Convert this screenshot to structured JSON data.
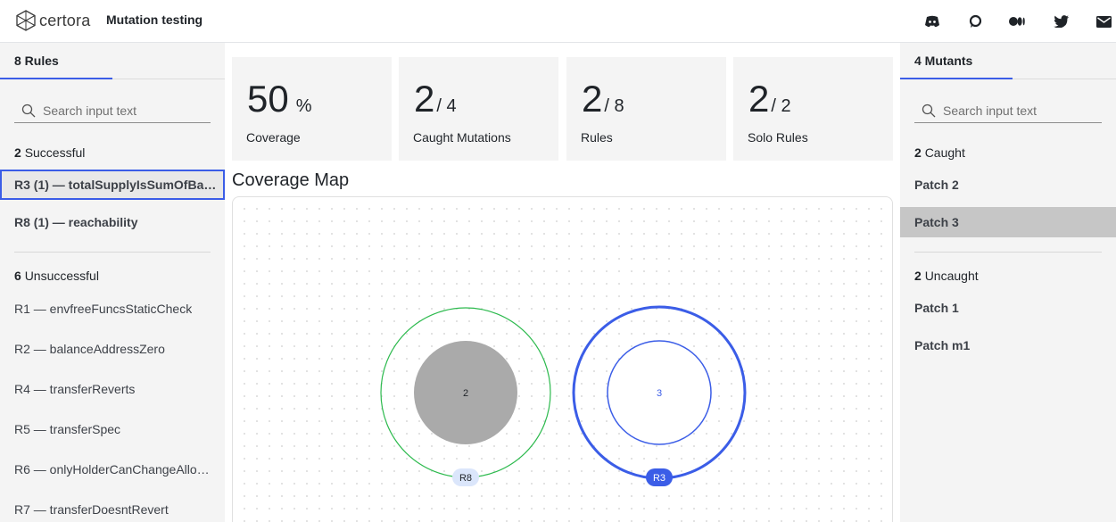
{
  "header": {
    "brand": "certora",
    "title": "Mutation testing",
    "social_icons": [
      "discord-icon",
      "chat-icon",
      "medium-icon",
      "twitter-icon",
      "mail-icon"
    ]
  },
  "rules_panel": {
    "tab_label": "8 Rules",
    "search_placeholder": "Search input text",
    "successful": {
      "count": "2",
      "label": "Successful"
    },
    "successful_items": [
      "R3 (1) — totalSupplyIsSumOfBa…",
      "R8 (1) — reachability"
    ],
    "unsuccessful": {
      "count": "6",
      "label": "Unsuccessful"
    },
    "unsuccessful_items": [
      "R1 — envfreeFuncsStaticCheck",
      "R2 — balanceAddressZero",
      "R4 — transferReverts",
      "R5 — transferSpec",
      "R6 — onlyHolderCanChangeAllo…",
      "R7 — transferDoesntRevert"
    ]
  },
  "metrics": [
    {
      "value": "50",
      "suffix": "%",
      "label": "Coverage"
    },
    {
      "value": "2",
      "suffix": "/ 4",
      "label": "Caught Mutations"
    },
    {
      "value": "2",
      "suffix": "/ 8",
      "label": "Rules"
    },
    {
      "value": "2",
      "suffix": "/ 2",
      "label": "Solo Rules"
    }
  ],
  "coverage_map": {
    "title": "Coverage Map",
    "nodes": [
      {
        "label": "R8",
        "inner_value": "2",
        "color": "#2dba4e",
        "inner_color": "#aaaaaa"
      },
      {
        "label": "R3",
        "inner_value": "3",
        "color": "#3b5de7",
        "inner_color": "#ffffff"
      }
    ]
  },
  "mutants_panel": {
    "tab_label": "4 Mutants",
    "search_placeholder": "Search input text",
    "caught": {
      "count": "2",
      "label": "Caught"
    },
    "caught_items": [
      "Patch 2",
      "Patch 3"
    ],
    "uncaught": {
      "count": "2",
      "label": "Uncaught"
    },
    "uncaught_items": [
      "Patch 1",
      "Patch m1"
    ]
  },
  "colors": {
    "accent": "#3b5de7",
    "success": "#2dba4e",
    "panel_bg": "#f4f4f4"
  }
}
